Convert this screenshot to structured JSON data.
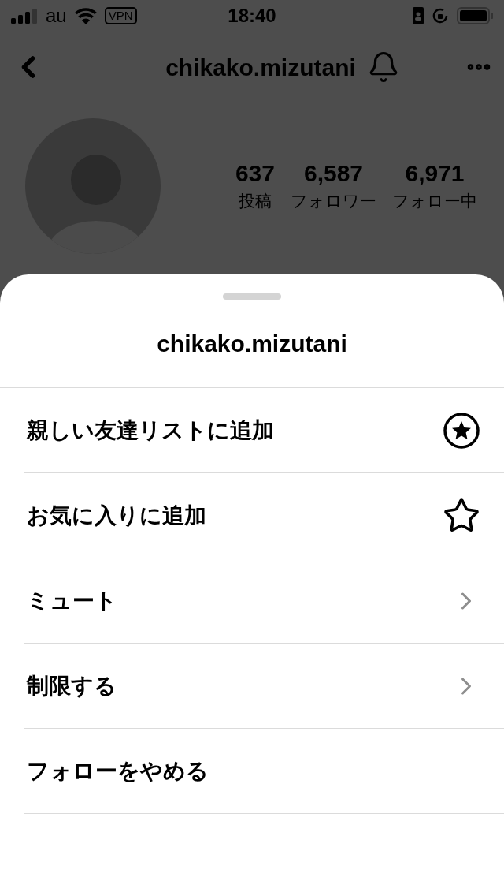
{
  "status_bar": {
    "carrier": "au",
    "vpn": "VPN",
    "time": "18:40"
  },
  "profile": {
    "username": "chikako.mizutani",
    "stats": [
      {
        "value": "637",
        "label": "投稿"
      },
      {
        "value": "6,587",
        "label": "フォロワー"
      },
      {
        "value": "6,971",
        "label": "フォロー中"
      }
    ]
  },
  "sheet": {
    "title": "chikako.mizutani",
    "items": [
      {
        "label": "親しい友達リストに追加",
        "kind": "star-circle"
      },
      {
        "label": "お気に入りに追加",
        "kind": "star"
      },
      {
        "label": "ミュート",
        "kind": "submenu"
      },
      {
        "label": "制限する",
        "kind": "submenu"
      },
      {
        "label": "フォローをやめる",
        "kind": "plain"
      }
    ]
  }
}
